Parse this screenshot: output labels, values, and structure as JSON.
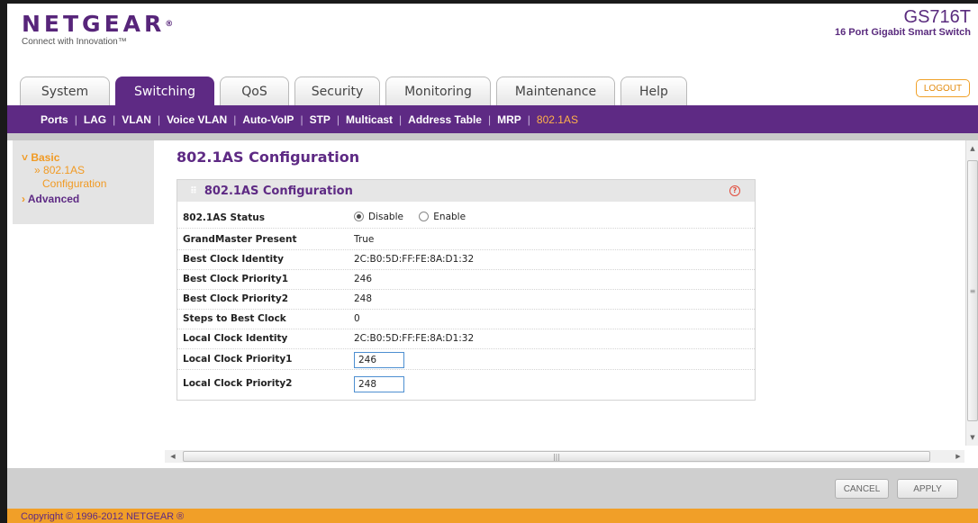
{
  "brand": {
    "logo": "NETGEAR",
    "tagline": "Connect with Innovation™"
  },
  "device": {
    "model": "GS716T",
    "description": "16 Port Gigabit Smart Switch"
  },
  "tabs": [
    {
      "label": "System",
      "active": false
    },
    {
      "label": "Switching",
      "active": true
    },
    {
      "label": "QoS",
      "active": false
    },
    {
      "label": "Security",
      "active": false
    },
    {
      "label": "Monitoring",
      "active": false
    },
    {
      "label": "Maintenance",
      "active": false
    },
    {
      "label": "Help",
      "active": false
    }
  ],
  "logout_label": "LOGOUT",
  "subnav": [
    {
      "label": "Ports",
      "active": false
    },
    {
      "label": "LAG",
      "active": false
    },
    {
      "label": "VLAN",
      "active": false
    },
    {
      "label": "Voice VLAN",
      "active": false
    },
    {
      "label": "Auto-VoIP",
      "active": false
    },
    {
      "label": "STP",
      "active": false
    },
    {
      "label": "Multicast",
      "active": false
    },
    {
      "label": "Address Table",
      "active": false
    },
    {
      "label": "MRP",
      "active": false
    },
    {
      "label": "802.1AS",
      "active": true
    }
  ],
  "leftnav": {
    "basic": "Basic",
    "basic_sub_1": "802.1AS",
    "basic_sub_2": "Configuration",
    "advanced": "Advanced"
  },
  "page": {
    "title": "802.1AS Configuration",
    "panel_title": "802.1AS Configuration",
    "status": {
      "label": "802.1AS Status",
      "options": [
        "Disable",
        "Enable"
      ],
      "selected": "Disable"
    },
    "rows": [
      {
        "label": "GrandMaster Present",
        "value": "True"
      },
      {
        "label": "Best Clock Identity",
        "value": "2C:B0:5D:FF:FE:8A:D1:32"
      },
      {
        "label": "Best Clock Priority1",
        "value": "246"
      },
      {
        "label": "Best Clock Priority2",
        "value": "248"
      },
      {
        "label": "Steps to Best Clock",
        "value": "0"
      },
      {
        "label": "Local Clock Identity",
        "value": "2C:B0:5D:FF:FE:8A:D1:32"
      }
    ],
    "inputs": [
      {
        "label": "Local Clock Priority1",
        "value": "246"
      },
      {
        "label": "Local Clock Priority2",
        "value": "248"
      }
    ]
  },
  "buttons": {
    "cancel": "CANCEL",
    "apply": "APPLY"
  },
  "copyright": "Copyright © 1996-2012 NETGEAR ®"
}
